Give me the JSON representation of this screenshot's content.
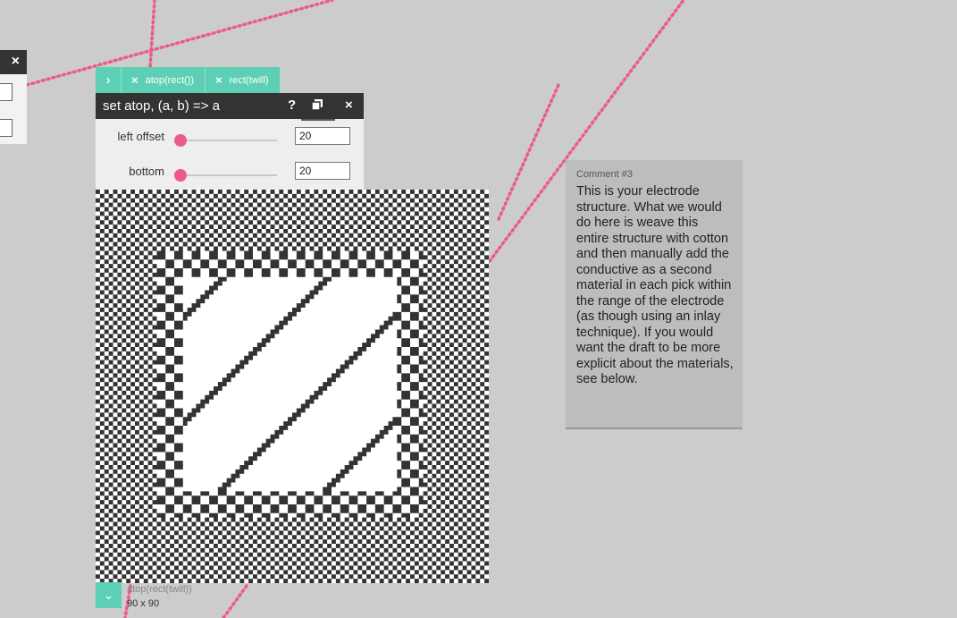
{
  "colors": {
    "background": "#cccccc",
    "accent_teal": "#5ecfb7",
    "accent_pink": "#ec5b86",
    "header_dark": "#333333",
    "draft_black": "#333333",
    "draft_white": "#ffffff"
  },
  "left_panel": {
    "close_icon": "×"
  },
  "tabs": {
    "expand_icon": "›",
    "items": [
      {
        "close_icon": "×",
        "label": "atop(rect())"
      },
      {
        "close_icon": "×",
        "label": "rect(twill)"
      }
    ]
  },
  "operation": {
    "title": "set atop, (a, b) => a",
    "help_icon": "?",
    "close_icon": "×",
    "params": [
      {
        "label": "left offset",
        "value": "20",
        "slider_fraction": 0
      },
      {
        "label": "bottom",
        "value": "20",
        "slider_fraction": 0
      }
    ]
  },
  "draft": {
    "name": "atop(rect(twill))",
    "size": "90 x 90",
    "expand_icon": "⌄"
  },
  "comment": {
    "title": "Comment #3",
    "text": "This is your electrode structure. What we would do here is weave this entire structure with cotton and then manually add the conductive as a second material in each pick within the range of the electrode (as though using an inlay technique). If you would want the draft to be more explicit about the materials, see below."
  }
}
